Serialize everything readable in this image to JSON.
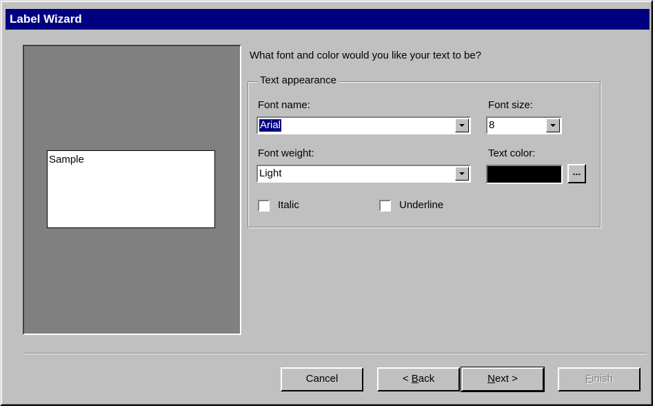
{
  "window": {
    "title": "Label Wizard"
  },
  "preview": {
    "sample_text": "Sample"
  },
  "question": "What font and color would you like your text to be?",
  "group": {
    "legend": "Text appearance",
    "font_name": {
      "label": "Font name:",
      "value": "Arial"
    },
    "font_size": {
      "label": "Font size:",
      "value": "8"
    },
    "font_weight": {
      "label": "Font weight:",
      "value": "Light"
    },
    "text_color": {
      "label": "Text color:",
      "swatch": "#000000",
      "button_label": "..."
    },
    "italic": {
      "label": "Italic",
      "checked": false
    },
    "underline": {
      "label": "Underline",
      "checked": false
    }
  },
  "buttons": {
    "cancel": "Cancel",
    "back_prefix": "< ",
    "back_mnemonic": "B",
    "back_rest": "ack",
    "next_mnemonic": "N",
    "next_rest": "ext >",
    "finish_mnemonic": "F",
    "finish_rest": "inish"
  },
  "colors": {
    "titlebar": "#000080",
    "dialog": "#c0c0c0",
    "preview_bg": "#808080"
  }
}
